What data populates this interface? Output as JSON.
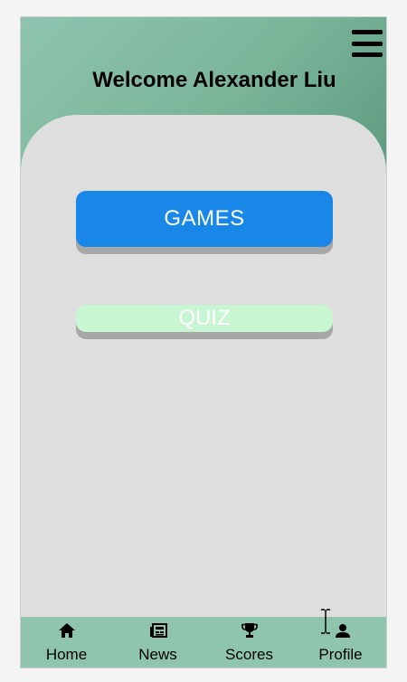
{
  "header": {
    "welcome_text": "Welcome Alexander Liu",
    "menu_icon": "hamburger-menu-icon",
    "gradient_color": "#7ab59a"
  },
  "main": {
    "buttons": [
      {
        "label": "GAMES",
        "color": "#1887e8"
      },
      {
        "label": "QUIZ",
        "color": "#c8f5d2"
      }
    ]
  },
  "bottom_nav": {
    "items": [
      {
        "label": "Home",
        "icon": "home-icon"
      },
      {
        "label": "News",
        "icon": "newspaper-icon"
      },
      {
        "label": "Scores",
        "icon": "trophy-icon"
      },
      {
        "label": "Profile",
        "icon": "profile-icon"
      }
    ],
    "background": "#8fc5ad"
  },
  "cursor": {
    "icon": "text-cursor-icon"
  }
}
